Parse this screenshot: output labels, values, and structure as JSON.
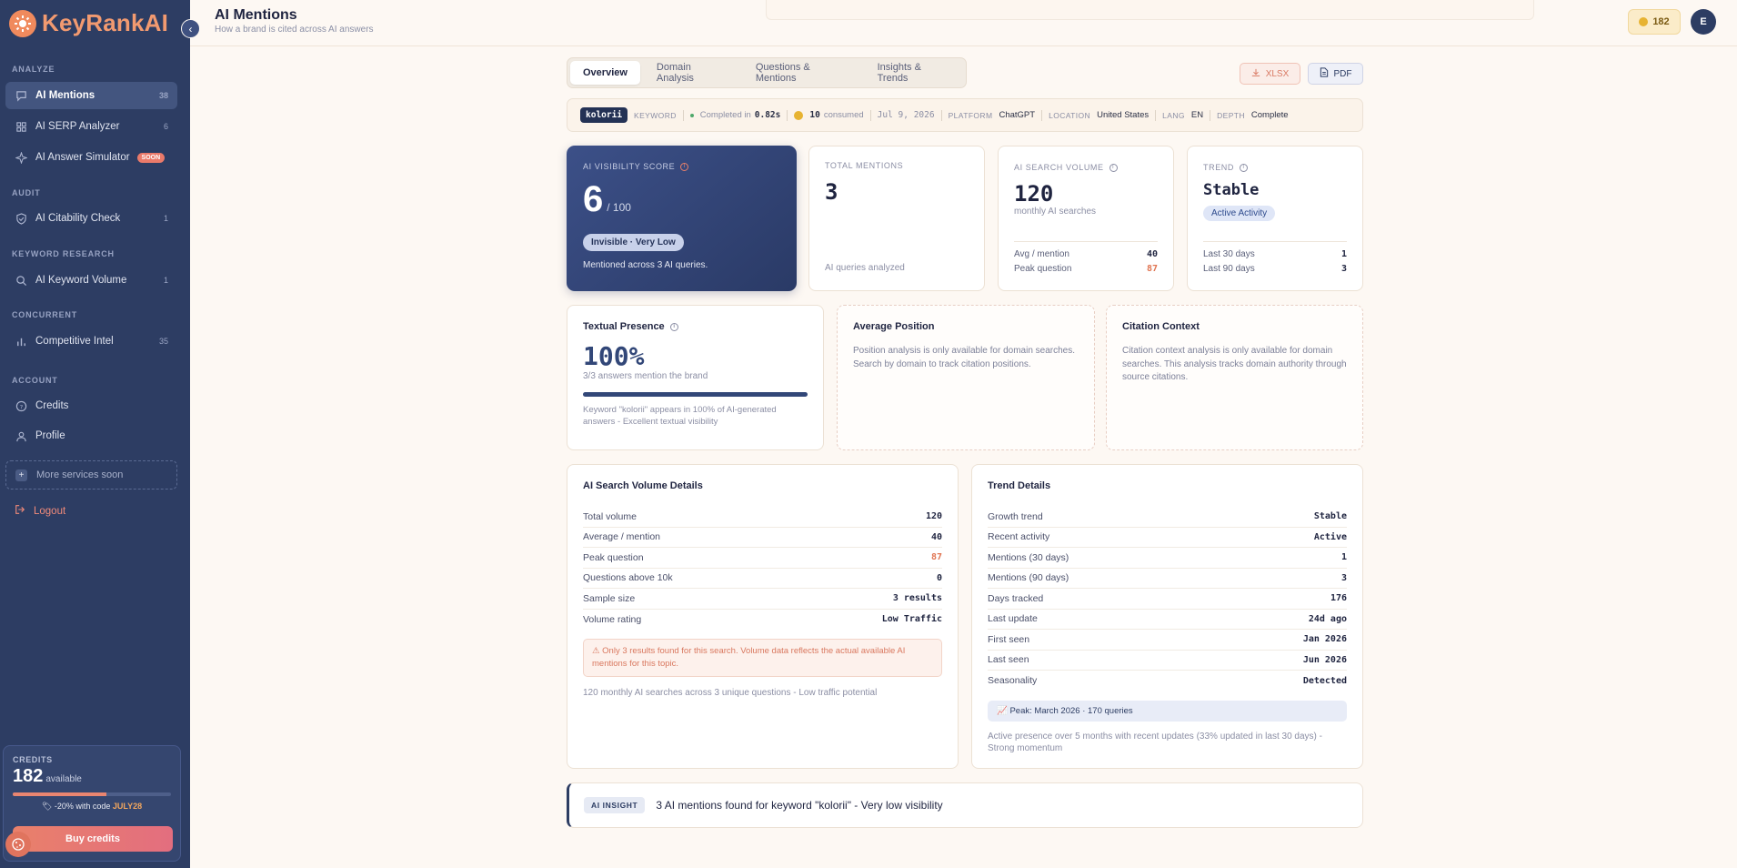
{
  "app": {
    "name": "KeyRankAI"
  },
  "sidebar": {
    "sections": {
      "analyze": "ANALYZE",
      "audit": "AUDIT",
      "keyword_research": "KEYWORD RESEARCH",
      "concurrent": "CONCURRENT",
      "account": "ACCOUNT"
    },
    "items": [
      {
        "label": "AI Mentions",
        "count": "38",
        "icon": "chat-bubble-icon"
      },
      {
        "label": "AI SERP Analyzer",
        "count": "6",
        "icon": "grid-icon"
      },
      {
        "label": "AI Answer Simulator",
        "badge": "SOON",
        "icon": "sparkle-icon"
      },
      {
        "label": "AI Citability Check",
        "count": "1",
        "icon": "shield-check-icon"
      },
      {
        "label": "AI Keyword Volume",
        "count": "1",
        "icon": "search-icon"
      },
      {
        "label": "Competitive Intel",
        "count": "35",
        "icon": "bar-chart-icon"
      },
      {
        "label": "Credits",
        "icon": "coin-circle-icon"
      },
      {
        "label": "Profile",
        "icon": "user-icon"
      }
    ],
    "more_soon": "More services soon",
    "logout": "Logout",
    "credits": {
      "label": "CREDITS",
      "amount": "182",
      "available": "available",
      "fill_fraction": 0.59,
      "promo_prefix": "-20% with code",
      "promo_code": "JULY28",
      "buy": "Buy credits"
    }
  },
  "header": {
    "title": "AI Mentions",
    "subtitle": "How a brand is cited across AI answers",
    "coins": "182",
    "avatar_initial": "E"
  },
  "tabs": [
    "Overview",
    "Domain Analysis",
    "Questions & Mentions",
    "Insights & Trends"
  ],
  "export": {
    "xlsx": "XLSX",
    "pdf": "PDF"
  },
  "meta": {
    "keyword": "kolorii",
    "keyword_label": "KEYWORD",
    "completed_prefix": "Completed in",
    "completed_time": "0.82s",
    "consumed_value": "10",
    "consumed_label": "consumed",
    "date": "Jul 9, 2026",
    "platform_label": "PLATFORM",
    "platform": "ChatGPT",
    "location_label": "LOCATION",
    "location": "United States",
    "lang_label": "LANG",
    "lang": "EN",
    "depth_label": "DEPTH",
    "depth": "Complete"
  },
  "visibility": {
    "label": "AI VISIBILITY SCORE",
    "score": "6",
    "max": "/ 100",
    "badge": "Invisible · Very Low",
    "footer": "Mentioned across 3 AI queries."
  },
  "total_mentions": {
    "label": "TOTAL MENTIONS",
    "value": "3",
    "footer": "AI queries analyzed"
  },
  "search_volume": {
    "label": "AI SEARCH VOLUME",
    "value": "120",
    "sub": "monthly AI searches",
    "avg_label": "Avg / mention",
    "avg": "40",
    "peak_label": "Peak question",
    "peak": "87"
  },
  "trend": {
    "label": "TREND",
    "value": "Stable",
    "pill": "Active Activity",
    "d30_label": "Last 30 days",
    "d30": "1",
    "d90_label": "Last 90 days",
    "d90": "3"
  },
  "textual": {
    "title": "Textual Presence",
    "value": "100%",
    "sub": "3/3 answers mention the brand",
    "fill_fraction": 1.0,
    "note": "Keyword \"kolorii\" appears in 100% of AI-generated answers - Excellent textual visibility"
  },
  "avg_position": {
    "title": "Average Position",
    "text": "Position analysis is only available for domain searches. Search by domain to track citation positions."
  },
  "citation_context": {
    "title": "Citation Context",
    "text": "Citation context analysis is only available for domain searches. This analysis tracks domain authority through source citations."
  },
  "volume_details": {
    "title": "AI Search Volume Details",
    "rows": [
      {
        "label": "Total volume",
        "value": "120"
      },
      {
        "label": "Average / mention",
        "value": "40"
      },
      {
        "label": "Peak question",
        "value": "87"
      },
      {
        "label": "Questions above 10k",
        "value": "0"
      },
      {
        "label": "Sample size",
        "value": "3 results"
      },
      {
        "label": "Volume rating",
        "value": "Low Traffic"
      }
    ],
    "warning": "⚠ Only 3 results found for this search. Volume data reflects the actual available AI mentions for this topic.",
    "footer": "120 monthly AI searches across 3 unique questions - Low traffic potential"
  },
  "trend_details": {
    "title": "Trend Details",
    "rows": [
      {
        "label": "Growth trend",
        "value": "Stable"
      },
      {
        "label": "Recent activity",
        "value": "Active"
      },
      {
        "label": "Mentions (30 days)",
        "value": "1"
      },
      {
        "label": "Mentions (90 days)",
        "value": "3"
      },
      {
        "label": "Days tracked",
        "value": "176"
      },
      {
        "label": "Last update",
        "value": "24d ago"
      },
      {
        "label": "First seen",
        "value": "Jan 2026"
      },
      {
        "label": "Last seen",
        "value": "Jun 2026"
      },
      {
        "label": "Seasonality",
        "value": "Detected"
      }
    ],
    "peak": "📈 Peak: March 2026 · 170 queries",
    "footer": "Active presence over 5 months with recent updates (33% updated in last 30 days) - Strong momentum"
  },
  "insight": {
    "badge": "AI INSIGHT",
    "text": "3 AI mentions found for keyword \"kolorii\" - Very low visibility"
  }
}
